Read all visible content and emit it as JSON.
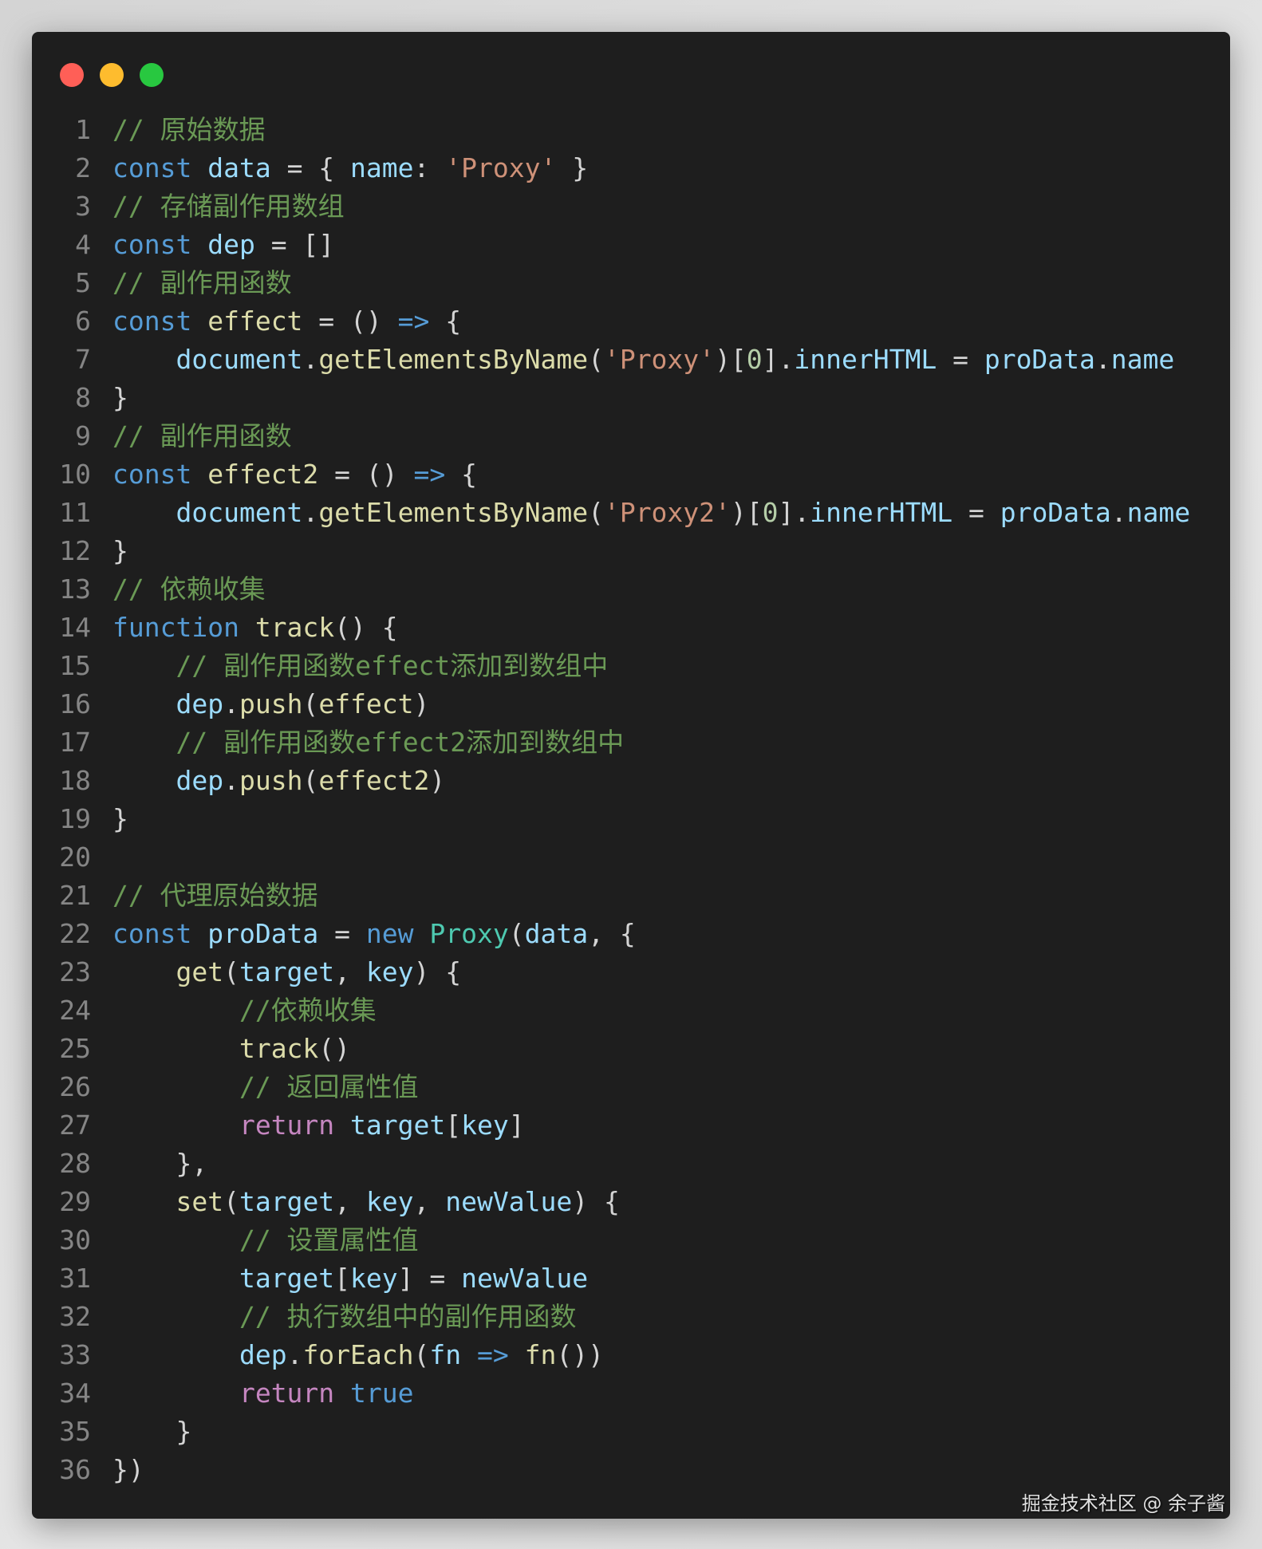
{
  "window": {
    "controls": [
      "close",
      "minimize",
      "maximize"
    ],
    "colors": {
      "close": "#ff5f57",
      "minimize": "#febc2e",
      "maximize": "#28c840",
      "background": "#1e1e1e"
    }
  },
  "code_lines": [
    [
      [
        "c",
        "// 原始数据"
      ]
    ],
    [
      [
        "k",
        "const "
      ],
      [
        "v",
        "data"
      ],
      [
        "t",
        " = { "
      ],
      [
        "v",
        "name"
      ],
      [
        "t",
        ": "
      ],
      [
        "s",
        "'Proxy'"
      ],
      [
        "t",
        " }"
      ]
    ],
    [
      [
        "c",
        "// 存储副作用数组"
      ]
    ],
    [
      [
        "k",
        "const "
      ],
      [
        "v",
        "dep"
      ],
      [
        "t",
        " = []"
      ]
    ],
    [
      [
        "c",
        "// 副作用函数"
      ]
    ],
    [
      [
        "k",
        "const "
      ],
      [
        "f",
        "effect"
      ],
      [
        "t",
        " = () "
      ],
      [
        "k",
        "=>"
      ],
      [
        "t",
        " {"
      ]
    ],
    [
      [
        "t",
        "    "
      ],
      [
        "v",
        "document"
      ],
      [
        "t",
        "."
      ],
      [
        "f",
        "getElementsByName"
      ],
      [
        "t",
        "("
      ],
      [
        "s",
        "'Proxy'"
      ],
      [
        "t",
        ")["
      ],
      [
        "n",
        "0"
      ],
      [
        "t",
        "]."
      ],
      [
        "v",
        "innerHTML"
      ],
      [
        "t",
        " = "
      ],
      [
        "v",
        "proData"
      ],
      [
        "t",
        "."
      ],
      [
        "v",
        "name"
      ]
    ],
    [
      [
        "t",
        "}"
      ]
    ],
    [
      [
        "c",
        "// 副作用函数"
      ]
    ],
    [
      [
        "k",
        "const "
      ],
      [
        "f",
        "effect2"
      ],
      [
        "t",
        " = () "
      ],
      [
        "k",
        "=>"
      ],
      [
        "t",
        " {"
      ]
    ],
    [
      [
        "t",
        "    "
      ],
      [
        "v",
        "document"
      ],
      [
        "t",
        "."
      ],
      [
        "f",
        "getElementsByName"
      ],
      [
        "t",
        "("
      ],
      [
        "s",
        "'Proxy2'"
      ],
      [
        "t",
        ")["
      ],
      [
        "n",
        "0"
      ],
      [
        "t",
        "]."
      ],
      [
        "v",
        "innerHTML"
      ],
      [
        "t",
        " = "
      ],
      [
        "v",
        "proData"
      ],
      [
        "t",
        "."
      ],
      [
        "v",
        "name"
      ]
    ],
    [
      [
        "t",
        "}"
      ]
    ],
    [
      [
        "c",
        "// 依赖收集"
      ]
    ],
    [
      [
        "k",
        "function "
      ],
      [
        "f",
        "track"
      ],
      [
        "t",
        "() {"
      ]
    ],
    [
      [
        "t",
        "    "
      ],
      [
        "c",
        "// 副作用函数effect添加到数组中"
      ]
    ],
    [
      [
        "t",
        "    "
      ],
      [
        "v",
        "dep"
      ],
      [
        "t",
        "."
      ],
      [
        "f",
        "push"
      ],
      [
        "t",
        "("
      ],
      [
        "f",
        "effect"
      ],
      [
        "t",
        ")"
      ]
    ],
    [
      [
        "t",
        "    "
      ],
      [
        "c",
        "// 副作用函数effect2添加到数组中"
      ]
    ],
    [
      [
        "t",
        "    "
      ],
      [
        "v",
        "dep"
      ],
      [
        "t",
        "."
      ],
      [
        "f",
        "push"
      ],
      [
        "t",
        "("
      ],
      [
        "f",
        "effect2"
      ],
      [
        "t",
        ")"
      ]
    ],
    [
      [
        "t",
        "}"
      ]
    ],
    [],
    [
      [
        "c",
        "// 代理原始数据"
      ]
    ],
    [
      [
        "k",
        "const "
      ],
      [
        "v",
        "proData"
      ],
      [
        "t",
        " = "
      ],
      [
        "k",
        "new "
      ],
      [
        "cl",
        "Proxy"
      ],
      [
        "t",
        "("
      ],
      [
        "v",
        "data"
      ],
      [
        "t",
        ", {"
      ]
    ],
    [
      [
        "t",
        "    "
      ],
      [
        "f",
        "get"
      ],
      [
        "t",
        "("
      ],
      [
        "v",
        "target"
      ],
      [
        "t",
        ", "
      ],
      [
        "v",
        "key"
      ],
      [
        "t",
        ") {"
      ]
    ],
    [
      [
        "t",
        "        "
      ],
      [
        "c",
        "//依赖收集"
      ]
    ],
    [
      [
        "t",
        "        "
      ],
      [
        "f",
        "track"
      ],
      [
        "t",
        "()"
      ]
    ],
    [
      [
        "t",
        "        "
      ],
      [
        "c",
        "// 返回属性值"
      ]
    ],
    [
      [
        "t",
        "        "
      ],
      [
        "r",
        "return "
      ],
      [
        "v",
        "target"
      ],
      [
        "t",
        "["
      ],
      [
        "v",
        "key"
      ],
      [
        "t",
        "]"
      ]
    ],
    [
      [
        "t",
        "    },"
      ]
    ],
    [
      [
        "t",
        "    "
      ],
      [
        "f",
        "set"
      ],
      [
        "t",
        "("
      ],
      [
        "v",
        "target"
      ],
      [
        "t",
        ", "
      ],
      [
        "v",
        "key"
      ],
      [
        "t",
        ", "
      ],
      [
        "v",
        "newValue"
      ],
      [
        "t",
        ") {"
      ]
    ],
    [
      [
        "t",
        "        "
      ],
      [
        "c",
        "// 设置属性值"
      ]
    ],
    [
      [
        "t",
        "        "
      ],
      [
        "v",
        "target"
      ],
      [
        "t",
        "["
      ],
      [
        "v",
        "key"
      ],
      [
        "t",
        "] = "
      ],
      [
        "v",
        "newValue"
      ]
    ],
    [
      [
        "t",
        "        "
      ],
      [
        "c",
        "// 执行数组中的副作用函数"
      ]
    ],
    [
      [
        "t",
        "        "
      ],
      [
        "v",
        "dep"
      ],
      [
        "t",
        "."
      ],
      [
        "f",
        "forEach"
      ],
      [
        "t",
        "("
      ],
      [
        "v",
        "fn"
      ],
      [
        "k",
        " => "
      ],
      [
        "f",
        "fn"
      ],
      [
        "t",
        "())"
      ]
    ],
    [
      [
        "t",
        "        "
      ],
      [
        "r",
        "return "
      ],
      [
        "k",
        "true"
      ]
    ],
    [
      [
        "t",
        "    }"
      ]
    ],
    [
      [
        "t",
        "})"
      ]
    ]
  ],
  "watermark": "掘金技术社区 @ 余子酱"
}
